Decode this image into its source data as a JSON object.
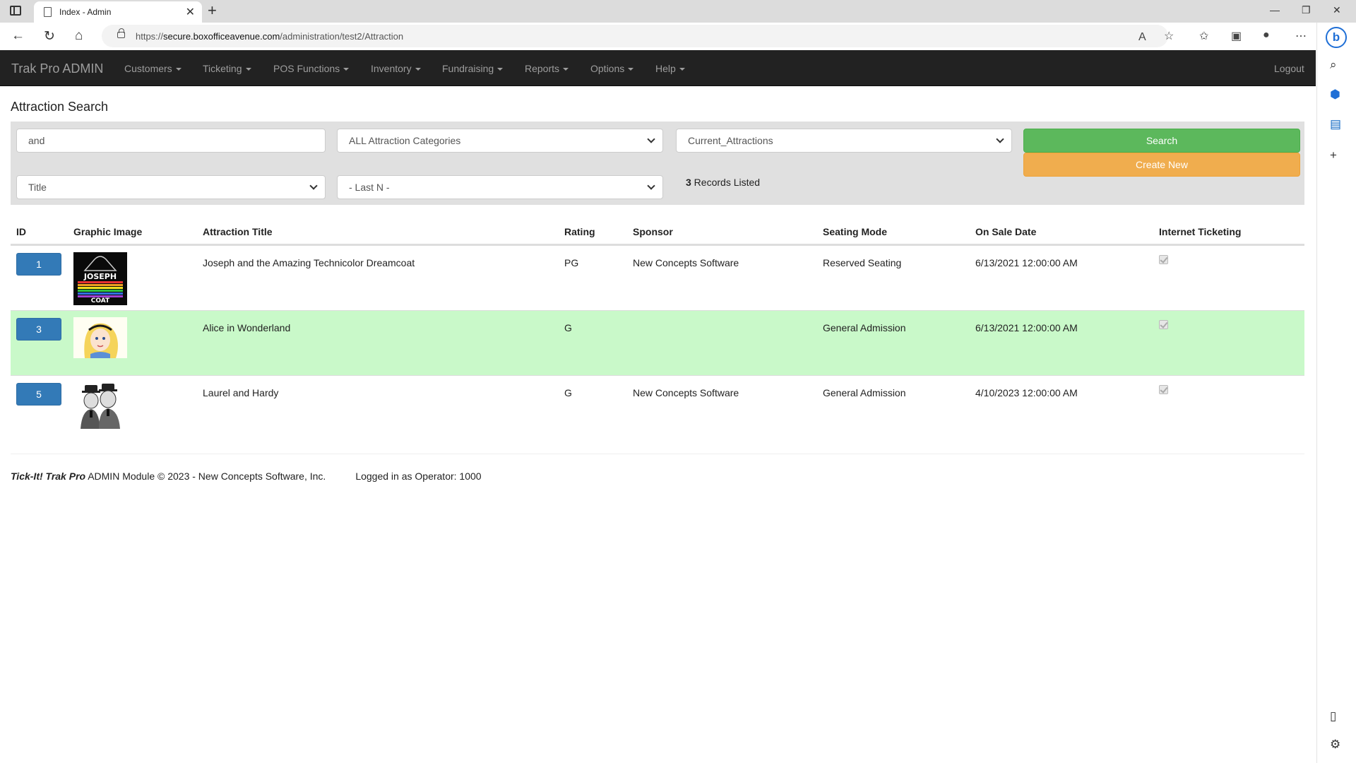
{
  "browser": {
    "tab_title": "Index - Admin",
    "url_prefix": "https://",
    "url_host": "secure.boxofficeavenue.com",
    "url_path": "/administration/test2/Attraction"
  },
  "navbar": {
    "brand": "Trak Pro ADMIN",
    "items": [
      "Customers",
      "Ticketing",
      "POS Functions",
      "Inventory",
      "Fundraising",
      "Reports",
      "Options",
      "Help"
    ],
    "logout": "Logout"
  },
  "page": {
    "title": "Attraction Search"
  },
  "search": {
    "keyword_value": "and",
    "category_selected": "ALL Attraction Categories",
    "status_selected": "Current_Attractions",
    "sort_selected": "Title",
    "lastn_selected": "- Last N -",
    "search_label": "Search",
    "create_label": "Create New",
    "records_count": "3",
    "records_suffix": " Records Listed"
  },
  "table": {
    "headers": [
      "ID",
      "Graphic Image",
      "Attraction Title",
      "Rating",
      "Sponsor",
      "Seating Mode",
      "On Sale Date",
      "Internet Ticketing"
    ],
    "rows": [
      {
        "id": "1",
        "title": "Joseph and the Amazing Technicolor Dreamcoat",
        "rating": "PG",
        "sponsor": "New Concepts Software",
        "seating": "Reserved Seating",
        "onsale": "6/13/2021 12:00:00 AM",
        "internet": true,
        "image_label": "JOSEPH AMAZING DREAMCOAT"
      },
      {
        "id": "3",
        "title": "Alice in Wonderland",
        "rating": "G",
        "sponsor": "",
        "seating": "General Admission",
        "onsale": "6/13/2021 12:00:00 AM",
        "internet": true
      },
      {
        "id": "5",
        "title": "Laurel and Hardy",
        "rating": "G",
        "sponsor": "New Concepts Software",
        "seating": "General Admission",
        "onsale": "4/10/2023 12:00:00 AM",
        "internet": true
      }
    ]
  },
  "footer": {
    "product": "Tick-It! Trak Pro",
    "module": " ADMIN Module © 2023 - New Concepts Software, Inc.",
    "operator": "Logged in as Operator: 1000"
  },
  "colors": {
    "navbar": "#222222",
    "search_button": "#5cb85c",
    "create_button": "#f0ad4e",
    "id_button": "#337ab7",
    "row_highlight": "#c9f9c9"
  }
}
